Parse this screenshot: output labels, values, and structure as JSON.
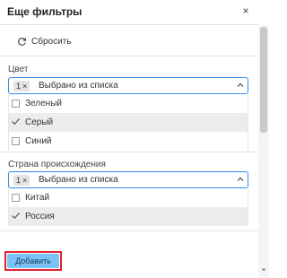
{
  "dialog": {
    "title": "Еще фильтры",
    "close_glyph": "×",
    "reset_label": "Сбросить"
  },
  "color_filter": {
    "label": "Цвет",
    "chip_count": "1",
    "chip_remove": "×",
    "selected_text": "Выбрано из списка",
    "options": [
      {
        "label": "Зеленый",
        "checked": false
      },
      {
        "label": "Серый",
        "checked": true
      },
      {
        "label": "Синий",
        "checked": false
      }
    ]
  },
  "country_filter": {
    "label": "Страна происхождения",
    "chip_count": "1",
    "chip_remove": "×",
    "selected_text": "Выбрано из списка",
    "options": [
      {
        "label": "Китай",
        "checked": false
      },
      {
        "label": "Россия",
        "checked": true
      }
    ]
  },
  "footer": {
    "add_label": "Добавить"
  },
  "colors": {
    "accent_border": "#2f8ef0",
    "button_bg": "#7cc3f5",
    "highlight_outline": "#e0202a"
  },
  "icons": {
    "reset": "refresh-icon",
    "close": "close-icon",
    "dropdown": "chevron-up-icon",
    "check": "checkmark-icon"
  }
}
